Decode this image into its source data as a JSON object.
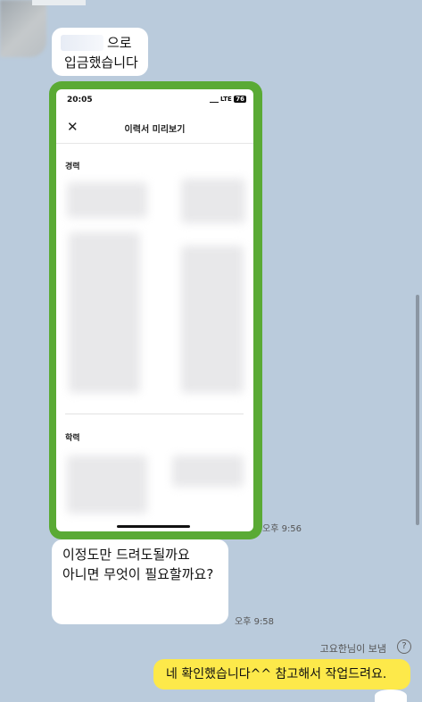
{
  "messages": {
    "m1_line1": "으로",
    "m1_line2": "입금했습니다",
    "screenshot_time": "오후 9:56",
    "m2_line1": "이정도만 드려도될까요",
    "m2_line2": "아니면 무엇이 필요할까요?",
    "m2_time": "오후 9:58",
    "sender_note": "고요한님이 보냄",
    "reply": "네 확인했습니다^^ 참고해서 작업드려요."
  },
  "phone": {
    "status_time": "20:05",
    "network": "LTE",
    "battery": "76",
    "title": "이력서 미리보기",
    "section_career": "경력",
    "section_education": "학력"
  },
  "colors": {
    "chat_bg": "#bacbdc",
    "frame_green": "#5aaa35",
    "my_bubble": "#fde94a"
  },
  "icons": [
    "close-icon",
    "help-icon"
  ]
}
